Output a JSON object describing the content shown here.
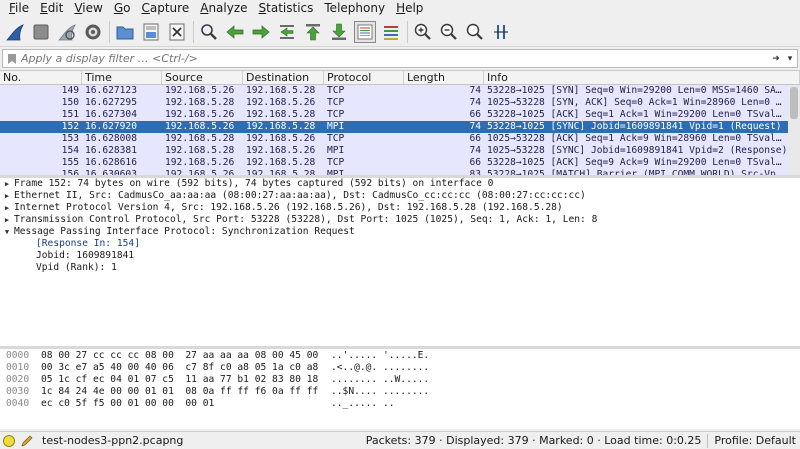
{
  "menu": {
    "items": [
      {
        "u": "F",
        "rest": "ile"
      },
      {
        "u": "E",
        "rest": "dit"
      },
      {
        "u": "V",
        "rest": "iew"
      },
      {
        "u": "G",
        "rest": "o"
      },
      {
        "u": "C",
        "rest": "apture"
      },
      {
        "u": "A",
        "rest": "nalyze"
      },
      {
        "u": "S",
        "rest": "tatistics"
      },
      {
        "u": "",
        "rest": "Telephony"
      },
      {
        "u": "H",
        "rest": "elp"
      }
    ]
  },
  "toolbar": {
    "icons": [
      "shark-fin-start-icon",
      "stop-square-icon",
      "restart-fin-icon",
      "options-gear-icon",
      "open-folder-icon",
      "save-file-icon",
      "close-file-icon",
      "find-magnifier-icon",
      "go-back-arrow-icon",
      "go-forward-arrow-icon",
      "go-to-packet-icon",
      "first-packet-icon",
      "last-packet-icon",
      "autoscroll-list-icon",
      "colorize-icon",
      "zoom-in-icon",
      "zoom-out-icon",
      "normal-size-icon",
      "resize-columns-icon"
    ]
  },
  "filter": {
    "placeholder": "Apply a display filter … <Ctrl-/>"
  },
  "packet_list": {
    "columns": [
      "No.",
      "Time",
      "Source",
      "Destination",
      "Protocol",
      "Length",
      "Info"
    ],
    "rows": [
      {
        "no": "149",
        "time": "16.627123",
        "src": "192.168.5.26",
        "dst": "192.168.5.28",
        "proto": "TCP",
        "len": "74",
        "info": "53228→1025 [SYN] Seq=0 Win=29200 Len=0 MSS=1460 SA…",
        "kind": "tcp"
      },
      {
        "no": "150",
        "time": "16.627295",
        "src": "192.168.5.28",
        "dst": "192.168.5.26",
        "proto": "TCP",
        "len": "74",
        "info": "1025→53228 [SYN, ACK] Seq=0 Ack=1 Win=28960 Len=0 …",
        "kind": "tcp"
      },
      {
        "no": "151",
        "time": "16.627304",
        "src": "192.168.5.26",
        "dst": "192.168.5.28",
        "proto": "TCP",
        "len": "66",
        "info": "53228→1025 [ACK] Seq=1 Ack=1 Win=29200 Len=0 TSval…",
        "kind": "tcp"
      },
      {
        "no": "152",
        "time": "16.627920",
        "src": "192.168.5.26",
        "dst": "192.168.5.28",
        "proto": "MPI",
        "len": "74",
        "info": "53228→1025 [SYNC] Jobid=1609891841 Vpid=1 (Request)",
        "kind": "sel"
      },
      {
        "no": "153",
        "time": "16.628008",
        "src": "192.168.5.28",
        "dst": "192.168.5.26",
        "proto": "TCP",
        "len": "66",
        "info": "1025→53228 [ACK] Seq=1 Ack=9 Win=28960 Len=0 TSval…",
        "kind": "tcp"
      },
      {
        "no": "154",
        "time": "16.628381",
        "src": "192.168.5.28",
        "dst": "192.168.5.26",
        "proto": "MPI",
        "len": "74",
        "info": "1025→53228 [SYNC] Jobid=1609891841 Vpid=2 (Response)",
        "kind": "tcp"
      },
      {
        "no": "155",
        "time": "16.628616",
        "src": "192.168.5.26",
        "dst": "192.168.5.28",
        "proto": "TCP",
        "len": "66",
        "info": "53228→1025 [ACK] Seq=9 Ack=9 Win=29200 Len=0 TSval…",
        "kind": "tcp"
      },
      {
        "no": "156",
        "time": "16.630603",
        "src": "192.168.5.26",
        "dst": "192.168.5.28",
        "proto": "MPI",
        "len": "83",
        "info": "53228→1025 [MATCH] Barrier (MPI_COMM_WORLD) Src-Vp…",
        "kind": "tcp"
      }
    ]
  },
  "details": {
    "rows": [
      {
        "text": "Frame 152: 74 bytes on wire (592 bits), 74 bytes captured (592 bits) on interface 0",
        "expander": "▶",
        "child": false,
        "link": false
      },
      {
        "text": "Ethernet II, Src: CadmusCo_aa:aa:aa (08:00:27:aa:aa:aa), Dst: CadmusCo_cc:cc:cc (08:00:27:cc:cc:cc)",
        "expander": "▶",
        "child": false,
        "link": false
      },
      {
        "text": "Internet Protocol Version 4, Src: 192.168.5.26 (192.168.5.26), Dst: 192.168.5.28 (192.168.5.28)",
        "expander": "▶",
        "child": false,
        "link": false
      },
      {
        "text": "Transmission Control Protocol, Src Port: 53228 (53228), Dst Port: 1025 (1025), Seq: 1, Ack: 1, Len: 8",
        "expander": "▶",
        "child": false,
        "link": false
      },
      {
        "text": "Message Passing Interface Protocol: Synchronization Request",
        "expander": "▼",
        "child": false,
        "link": false
      },
      {
        "text": "[Response In: 154]",
        "expander": "",
        "child": true,
        "link": true
      },
      {
        "text": "Jobid: 1609891841",
        "expander": "",
        "child": true,
        "link": false
      },
      {
        "text": "Vpid (Rank): 1",
        "expander": "",
        "child": true,
        "link": false
      }
    ]
  },
  "bytes": {
    "rows": [
      {
        "off": "0000",
        "hex": "08 00 27 cc cc cc 08 00  27 aa aa aa 08 00 45 00",
        "ascii": "..'..... '.....E."
      },
      {
        "off": "0010",
        "hex": "00 3c e7 a5 40 00 40 06  c7 8f c0 a8 05 1a c0 a8",
        "ascii": ".<..@.@. ........"
      },
      {
        "off": "0020",
        "hex": "05 1c cf ec 04 01 07 c5  11 aa 77 b1 02 83 80 18",
        "ascii": "........ ..W....."
      },
      {
        "off": "0030",
        "hex": "1c 84 24 4e 00 00 01 01  08 0a ff ff f6 0a ff ff",
        "ascii": "..$N.... ........"
      },
      {
        "off": "0040",
        "hex": "ec c0 5f f5 00 01 00 00  00 01",
        "ascii": ".._..... .."
      }
    ]
  },
  "status": {
    "file": "test-nodes3-ppn2.pcapng",
    "stats": "Packets: 379 · Displayed: 379 · Marked: 0 · Load time: 0:0.25",
    "profile": "Profile: Default"
  }
}
